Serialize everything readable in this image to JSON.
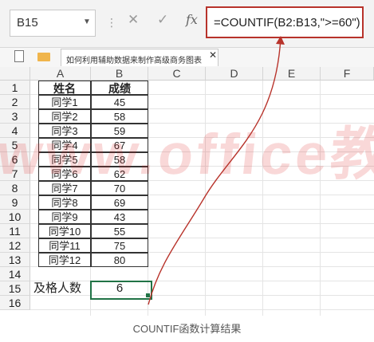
{
  "formula_bar": {
    "name_box": "B15",
    "name_box_arrow": "▼",
    "separator": "⋮",
    "cancel_icon": "✕",
    "enter_icon": "✓",
    "fx_icon": "fx",
    "formula": "=COUNTIF(B2:B13,\">=60\")"
  },
  "tab_bar": {
    "workbook_tab": "如何利用辅助数据来制作高级商务图表",
    "close_icon": "✕"
  },
  "sheet": {
    "columns": [
      "A",
      "B",
      "C",
      "D",
      "E",
      "F"
    ],
    "rows": [
      "1",
      "2",
      "3",
      "4",
      "5",
      "6",
      "7",
      "8",
      "9",
      "10",
      "11",
      "12",
      "13",
      "14",
      "15",
      "16"
    ],
    "header": {
      "name": "姓名",
      "score": "成绩"
    },
    "students": [
      {
        "name": "同学1",
        "score": "45"
      },
      {
        "name": "同学2",
        "score": "58"
      },
      {
        "name": "同学3",
        "score": "59"
      },
      {
        "name": "同学4",
        "score": "67"
      },
      {
        "name": "同学5",
        "score": "58"
      },
      {
        "name": "同学6",
        "score": "62"
      },
      {
        "name": "同学7",
        "score": "70"
      },
      {
        "name": "同学8",
        "score": "69"
      },
      {
        "name": "同学9",
        "score": "43"
      },
      {
        "name": "同学10",
        "score": "55"
      },
      {
        "name": "同学11",
        "score": "75"
      },
      {
        "name": "同学12",
        "score": "80"
      }
    ],
    "result_label": "及格人数",
    "result_value": "6"
  },
  "watermark": "www.office教程网",
  "caption": "COUNTIF函数计算结果",
  "colors": {
    "accent_red": "#b8332b",
    "selection_green": "#217346"
  }
}
